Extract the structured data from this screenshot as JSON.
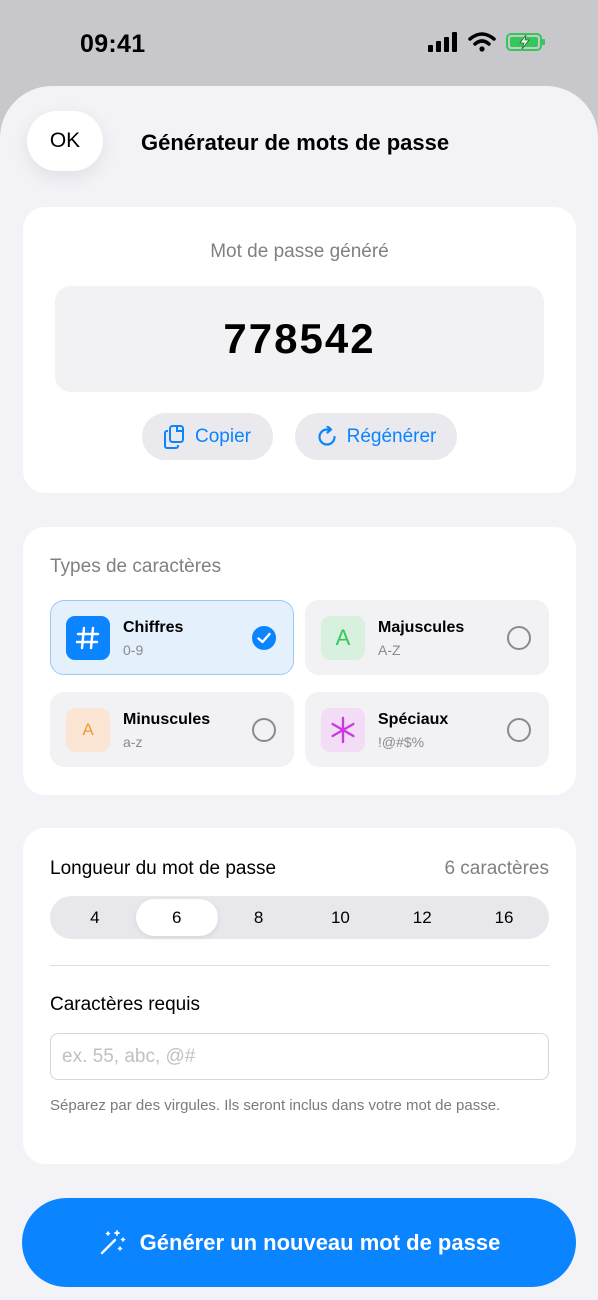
{
  "status_bar": {
    "time": "09:41"
  },
  "header": {
    "ok_label": "OK",
    "title": "Générateur de mots de passe"
  },
  "password_card": {
    "label": "Mot de passe généré",
    "value": "778542",
    "copy_label": "Copier",
    "regenerate_label": "Régénérer"
  },
  "char_types": {
    "label": "Types de caractères",
    "items": [
      {
        "name": "Chiffres",
        "range": "0-9",
        "icon": "hash-icon",
        "glyph": "#",
        "selected": true,
        "icon_bg": "#0a84ff",
        "icon_color": "#ffffff"
      },
      {
        "name": "Majuscules",
        "range": "A-Z",
        "icon": "uppercase-a-icon",
        "glyph": "A",
        "selected": false,
        "icon_bg": "#d8f1df",
        "icon_color": "#34c759"
      },
      {
        "name": "Minuscules",
        "range": "a-z",
        "icon": "lowercase-a-icon",
        "glyph": "A",
        "selected": false,
        "icon_bg": "#fbe6d6",
        "icon_color": "#f09a3a"
      },
      {
        "name": "Spéciaux",
        "range": "!@#$%",
        "icon": "asterisk-icon",
        "glyph": "✳",
        "selected": false,
        "icon_bg": "#f2dcf6",
        "icon_color": "#c93be0"
      }
    ]
  },
  "length": {
    "label": "Longueur du mot de passe",
    "value_text": "6 caractères",
    "options": [
      "4",
      "6",
      "8",
      "10",
      "12",
      "16"
    ],
    "selected": "6"
  },
  "required_chars": {
    "label": "Caractères requis",
    "value": "",
    "placeholder": "ex. 55, abc, @#",
    "hint": "Séparez par des virgules. Ils seront inclus dans votre mot de passe."
  },
  "generate_button": {
    "label": "Générer un nouveau mot de passe",
    "icon": "magic-wand-icon"
  },
  "colors": {
    "accent": "#0a84ff",
    "background": "#f2f2f7",
    "card": "#ffffff"
  }
}
